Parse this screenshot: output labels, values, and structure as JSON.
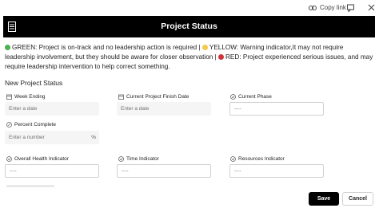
{
  "toolbar": {
    "copy_link_label": "Copy link",
    "icons": [
      "link-icon",
      "feedback-icon",
      "close-icon"
    ]
  },
  "banner": {
    "title": "Project Status",
    "icon": "document-icon",
    "background": "#000000"
  },
  "legend": {
    "green_text": "GREEN: Project is on-track and no leadership action is required | ",
    "yellow_text": "YELLOW: Warning indicator,It may not require leadership involvement, but they should be aware for closer observation | ",
    "red_text": "RED: Project experienced serious issues, and may require leadership intervention to help correct something.",
    "colors": {
      "green": "#4caf50",
      "yellow": "#f2c94c",
      "red": "#d13438"
    }
  },
  "form": {
    "section_title": "New Project Status",
    "week_ending": {
      "label": "Week Ending",
      "placeholder": "Enter a date",
      "icon": "calendar-icon"
    },
    "finish_date": {
      "label": "Current Project Finish Date",
      "placeholder": "Enter a date",
      "icon": "calendar-icon"
    },
    "current_phase": {
      "label": "Current Phase",
      "value": "----",
      "icon": "choice-icon"
    },
    "percent_complete": {
      "label": "Percent Complete",
      "placeholder": "Enter a number",
      "suffix": "%",
      "icon": "percent-icon"
    },
    "overall_health": {
      "label": "Overall Health Indicator",
      "value": "----",
      "icon": "choice-icon"
    },
    "time_indicator": {
      "label": "Time Indicator",
      "value": "----",
      "icon": "choice-icon"
    },
    "resources_indicator": {
      "label": "Resources Indicator",
      "value": "----",
      "icon": "choice-icon"
    }
  },
  "actions": {
    "save_label": "Save",
    "cancel_label": "Cancel"
  }
}
